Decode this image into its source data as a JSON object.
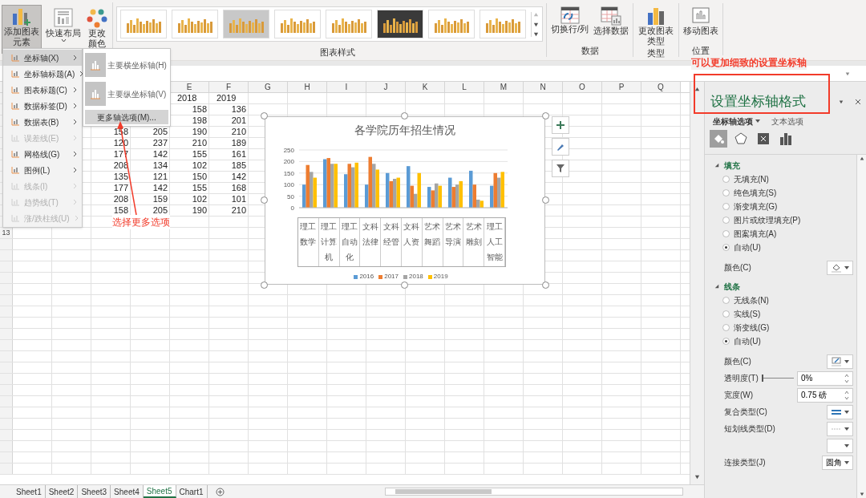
{
  "ribbon": {
    "buttons": [
      {
        "label": "添加图表元素",
        "selected": true,
        "kind": "elements"
      },
      {
        "label": "快速布局",
        "selected": false,
        "kind": "layout"
      },
      {
        "label": "更改颜色",
        "selected": false,
        "kind": "colors"
      }
    ],
    "styles": {
      "label": "图表样式",
      "thumbnails": [
        {
          "kind": "light"
        },
        {
          "kind": "light"
        },
        {
          "kind": "gray"
        },
        {
          "kind": "light"
        },
        {
          "kind": "light"
        },
        {
          "kind": "dark"
        },
        {
          "kind": "light"
        },
        {
          "kind": "light"
        }
      ]
    },
    "groups": [
      {
        "label": "数据",
        "buttons": [
          {
            "label": "切换行/列",
            "kind": "switch"
          },
          {
            "label": "选择数据",
            "kind": "select"
          }
        ]
      },
      {
        "label": "类型",
        "buttons": [
          {
            "label": "更改图表类型",
            "kind": "type"
          }
        ]
      },
      {
        "label": "位置",
        "buttons": [
          {
            "label": "移动图表",
            "kind": "move"
          }
        ]
      }
    ]
  },
  "menu": {
    "items": [
      {
        "label": "坐标轴(X)",
        "disabled": false,
        "selected": true
      },
      {
        "label": "坐标轴标题(A)",
        "disabled": false,
        "selected": false
      },
      {
        "label": "图表标题(C)",
        "disabled": false,
        "selected": false
      },
      {
        "label": "数据标签(D)",
        "disabled": false,
        "selected": false
      },
      {
        "label": "数据表(B)",
        "disabled": false,
        "selected": false
      },
      {
        "label": "误差线(E)",
        "disabled": true,
        "selected": false
      },
      {
        "label": "网格线(G)",
        "disabled": false,
        "selected": false
      },
      {
        "label": "图例(L)",
        "disabled": false,
        "selected": false
      },
      {
        "label": "线条(I)",
        "disabled": true,
        "selected": false
      },
      {
        "label": "趋势线(T)",
        "disabled": true,
        "selected": false
      },
      {
        "label": "涨/跌柱线(U)",
        "disabled": true,
        "selected": false
      }
    ],
    "submenu": [
      {
        "label": "主要横坐标轴(H)",
        "kind": "option",
        "selected": false
      },
      {
        "label": "主要纵坐标轴(V)",
        "kind": "option",
        "selected": false
      },
      {
        "label": "更多轴选项(M)...",
        "kind": "more",
        "selected": true
      }
    ]
  },
  "sheet": {
    "columns": [
      "E",
      "F",
      "G",
      "H",
      "I",
      "J",
      "K",
      "L",
      "M",
      "N",
      "O",
      "P",
      "Q"
    ],
    "row_numbers": [
      "13"
    ],
    "rows": [
      {
        "kind": "header",
        "cells": [
          null,
          null,
          "2018",
          "2019"
        ]
      },
      {
        "kind": "data",
        "cells": [
          null,
          null,
          "158",
          "136"
        ]
      },
      {
        "kind": "data",
        "cells": [
          null,
          null,
          "198",
          "201"
        ]
      },
      {
        "kind": "data",
        "cells": [
          "158",
          "205",
          "190",
          "210"
        ]
      },
      {
        "kind": "data",
        "cells": [
          "120",
          "237",
          "210",
          "189"
        ]
      },
      {
        "kind": "data",
        "cells": [
          "177",
          "142",
          "155",
          "161"
        ]
      },
      {
        "kind": "data",
        "cells": [
          "208",
          "134",
          "102",
          "185"
        ]
      },
      {
        "kind": "data",
        "cells": [
          "135",
          "121",
          "150",
          "142"
        ]
      },
      {
        "kind": "data",
        "cells": [
          "177",
          "142",
          "155",
          "168"
        ]
      },
      {
        "kind": "data",
        "cells": [
          "208",
          "159",
          "102",
          "101"
        ]
      },
      {
        "kind": "data",
        "cells": [
          "158",
          "205",
          "190",
          "210"
        ]
      }
    ],
    "tabs": [
      {
        "label": "Sheet1",
        "selected": false
      },
      {
        "label": "Sheet2",
        "selected": false
      },
      {
        "label": "Sheet3",
        "selected": false
      },
      {
        "label": "Sheet4",
        "selected": false
      },
      {
        "label": "Sheet5",
        "selected": true
      },
      {
        "label": "Chart1",
        "selected": false
      }
    ]
  },
  "chart": {
    "chart_data": {
      "type": "bar",
      "title": "各学院历年招生情况",
      "categories": [
        "理工数学",
        "理工计算机",
        "理工自动化",
        "文科法律",
        "文科经管",
        "文科人资",
        "艺术舞蹈",
        "艺术导演",
        "艺术雕刻",
        "理工人工智能"
      ],
      "yticks": [
        0,
        50,
        100,
        150,
        200,
        250
      ],
      "ylim": [
        0,
        250
      ],
      "stacked": false,
      "grid": true,
      "legend": "bottom",
      "series": [
        {
          "name": "2016",
          "color": "#5b9bd5",
          "values": [
            100,
            210,
            145,
            100,
            150,
            180,
            90,
            130,
            160,
            95
          ]
        },
        {
          "name": "2017",
          "color": "#ed7d31",
          "values": [
            185,
            215,
            190,
            220,
            115,
            95,
            75,
            90,
            100,
            150
          ]
        },
        {
          "name": "2018",
          "color": "#a5a5a5",
          "values": [
            155,
            190,
            175,
            190,
            125,
            60,
            105,
            100,
            35,
            130
          ]
        },
        {
          "name": "2019",
          "color": "#ffc000",
          "values": [
            130,
            190,
            195,
            165,
            130,
            150,
            95,
            115,
            30,
            155
          ]
        }
      ]
    }
  },
  "annotations": {
    "menu_note": "选择更多选项",
    "pane_note": "可以更加细致的设置坐标轴"
  },
  "pane": {
    "title": "设置坐标轴格式",
    "tabs": [
      {
        "label": "坐标轴选项",
        "selected": true
      },
      {
        "label": "文本选项",
        "selected": false
      }
    ],
    "icons": [
      {
        "kind": "fill",
        "selected": true
      },
      {
        "kind": "effects",
        "selected": false
      },
      {
        "kind": "size",
        "selected": false
      },
      {
        "kind": "axis",
        "selected": false
      }
    ],
    "sections": [
      {
        "title": "填充",
        "expanded": true,
        "options": [
          {
            "label": "无填充(N)",
            "selected": false
          },
          {
            "label": "纯色填充(S)",
            "selected": false
          },
          {
            "label": "渐变填充(G)",
            "selected": false
          },
          {
            "label": "图片或纹理填充(P)",
            "selected": false
          },
          {
            "label": "图案填充(A)",
            "selected": false
          },
          {
            "label": "自动(U)",
            "selected": true
          }
        ],
        "fields": [
          {
            "label": "颜色(C)",
            "kind": "bucket"
          }
        ]
      },
      {
        "title": "线条",
        "expanded": true,
        "options": [
          {
            "label": "无线条(N)",
            "selected": false
          },
          {
            "label": "实线(S)",
            "selected": false
          },
          {
            "label": "渐变线(G)",
            "selected": false
          },
          {
            "label": "自动(U)",
            "selected": true
          }
        ],
        "fields": [
          {
            "label": "颜色(C)",
            "kind": "pen"
          },
          {
            "label": "透明度(T)",
            "kind": "slider",
            "level": 0,
            "value": "0%"
          },
          {
            "label": "宽度(W)",
            "kind": "spin",
            "value": "0.75 磅"
          },
          {
            "label": "复合类型(C)",
            "kind": "compound"
          },
          {
            "label": "短划线类型(D)",
            "kind": "dash"
          },
          {
            "kind": "dropdown"
          },
          {
            "label": "连接类型(J)",
            "kind": "select",
            "value": "圆角"
          }
        ]
      }
    ]
  }
}
